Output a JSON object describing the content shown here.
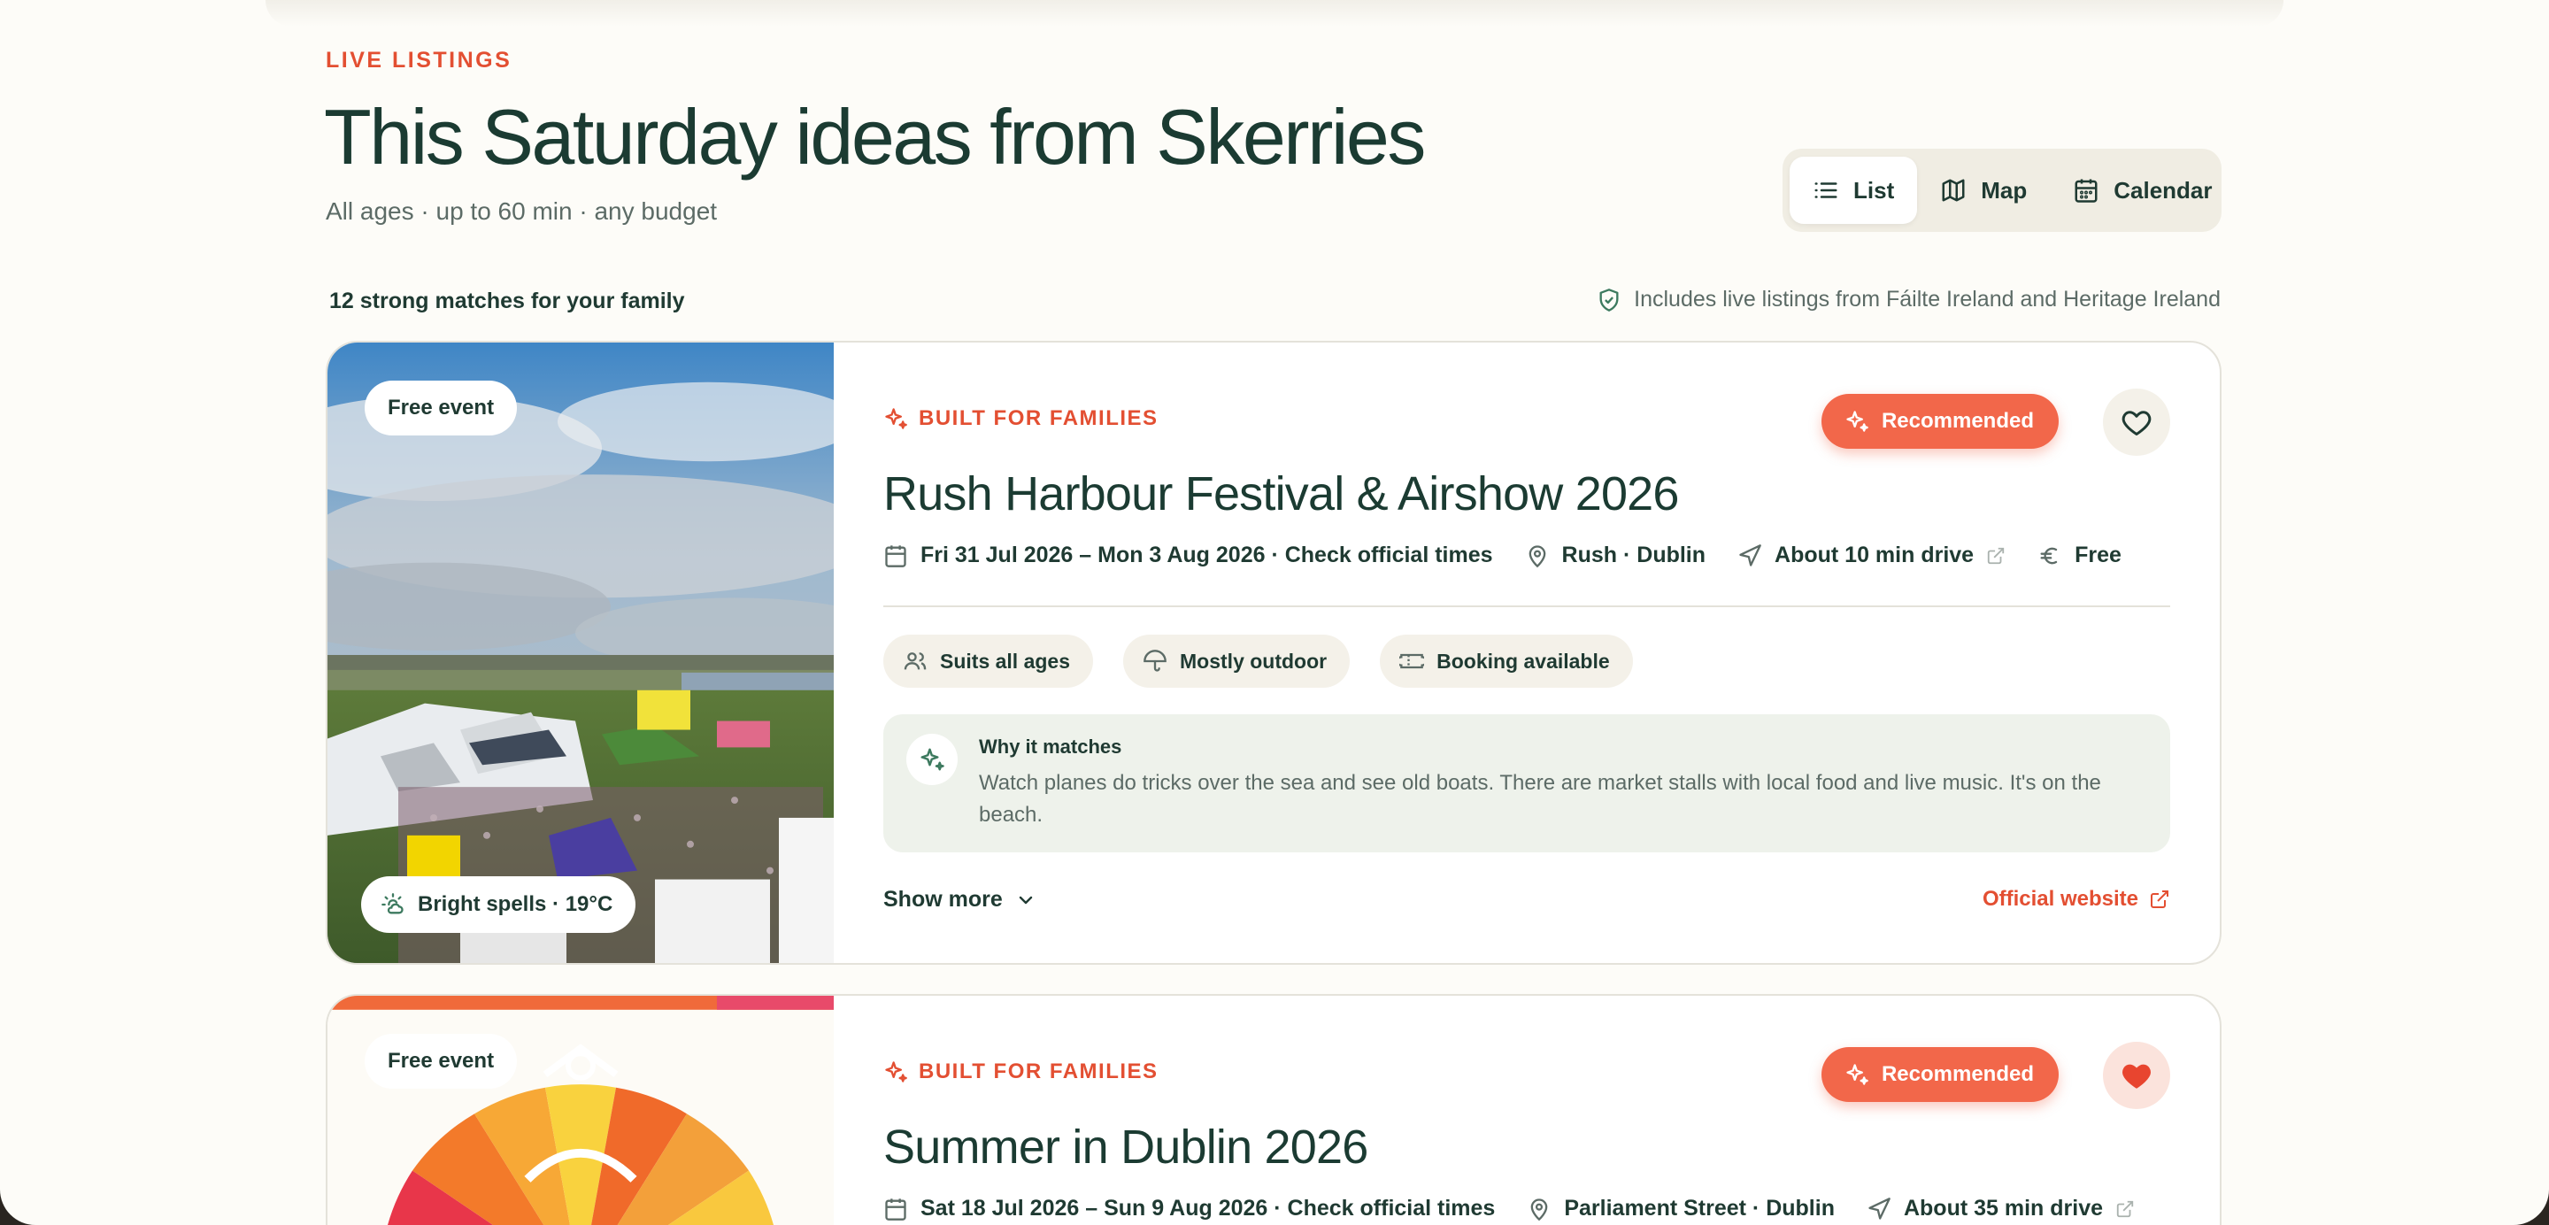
{
  "header": {
    "kicker": "LIVE LISTINGS",
    "title": "This Saturday ideas from Skerries",
    "subtitle": "All ages · up to 60 min · any budget"
  },
  "view_switch": {
    "options": [
      {
        "label": "List",
        "icon": "list-icon",
        "active": true
      },
      {
        "label": "Map",
        "icon": "map-icon",
        "active": false
      },
      {
        "label": "Calendar",
        "icon": "calendar-icon",
        "active": false
      }
    ]
  },
  "results": {
    "count_text": "12 strong matches for your family",
    "source_text": "Includes live listings from Fáilte Ireland and Heritage Ireland"
  },
  "colors": {
    "accent": "#e34f32",
    "recommended": "#f2674a",
    "text_dark": "#1b3b32",
    "muted": "#5c6b66",
    "why_bg": "#eef2eb"
  },
  "cards": [
    {
      "image_badge": "Free event",
      "weather": "Bright spells · 19°C",
      "category": "BUILT FOR FAMILIES",
      "recommended_label": "Recommended",
      "favorited": false,
      "title": "Rush Harbour Festival & Airshow 2026",
      "dates": "Fri 31 Jul 2026 – Mon 3 Aug 2026 · Check official times",
      "location": "Rush · Dublin",
      "travel": "About 10 min drive",
      "price": "Free",
      "tags": [
        "Suits all ages",
        "Mostly outdoor",
        "Booking available"
      ],
      "why_title": "Why it matches",
      "why_text": "Watch planes do tricks over the sea and see old boats. There are market stalls with local food and live music. It's on the beach.",
      "show_more": "Show more",
      "official_link": "Official website"
    },
    {
      "image_badge": "Free event",
      "category": "BUILT FOR FAMILIES",
      "recommended_label": "Recommended",
      "favorited": true,
      "title": "Summer in Dublin 2026",
      "dates": "Sat 18 Jul 2026 – Sun 9 Aug 2026 · Check official times",
      "location": "Parliament Street · Dublin",
      "travel": "About 35 min drive"
    }
  ]
}
